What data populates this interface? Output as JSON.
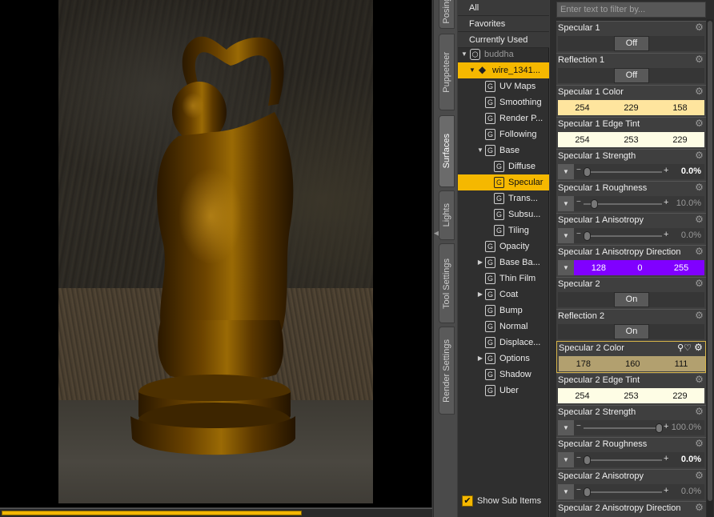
{
  "viewport": {
    "progress": 0.7
  },
  "side_tabs": [
    {
      "label": "Posing",
      "active": false
    },
    {
      "label": "Puppeteer",
      "active": false
    },
    {
      "label": "Surfaces",
      "active": true
    },
    {
      "label": "Lights",
      "active": false
    },
    {
      "label": "Tool Settings",
      "active": false
    },
    {
      "label": "Render Settings",
      "active": false
    }
  ],
  "tree": {
    "categories": [
      "All",
      "Favorites",
      "Currently Used"
    ],
    "figure": "buddha",
    "selected_object": "wire_1341...",
    "items": [
      {
        "label": "UV Maps"
      },
      {
        "label": "Smoothing"
      },
      {
        "label": "Render P..."
      },
      {
        "label": "Following"
      },
      {
        "label": "Base"
      },
      {
        "label": "Diffuse"
      },
      {
        "label": "Specular"
      },
      {
        "label": "Trans..."
      },
      {
        "label": "Subsu..."
      },
      {
        "label": "Tiling"
      },
      {
        "label": "Opacity"
      },
      {
        "label": "Base Ba..."
      },
      {
        "label": "Thin Film"
      },
      {
        "label": "Coat"
      },
      {
        "label": "Bump"
      },
      {
        "label": "Normal"
      },
      {
        "label": "Displace..."
      },
      {
        "label": "Options"
      },
      {
        "label": "Shadow"
      },
      {
        "label": "Uber"
      }
    ],
    "show_sub_items": "Show Sub Items"
  },
  "properties": {
    "filter_placeholder": "Enter text to filter by...",
    "items": [
      {
        "name": "Specular 1",
        "kind": "toggle",
        "value": "Off"
      },
      {
        "name": "Reflection 1",
        "kind": "toggle",
        "value": "Off"
      },
      {
        "name": "Specular 1 Color",
        "kind": "color",
        "rgb": [
          "254",
          "229",
          "158"
        ],
        "color": "#fee59e"
      },
      {
        "name": "Specular 1 Edge Tint",
        "kind": "color",
        "rgb": [
          "254",
          "253",
          "229"
        ],
        "color": "#fefde5"
      },
      {
        "name": "Specular 1 Strength",
        "kind": "slider",
        "value": "0.0%",
        "fraction": 0.0,
        "bold": true
      },
      {
        "name": "Specular 1 Roughness",
        "kind": "slider",
        "value": "10.0%",
        "fraction": 0.1,
        "bold": false
      },
      {
        "name": "Specular 1 Anisotropy",
        "kind": "slider",
        "value": "0.0%",
        "fraction": 0.0,
        "bold": false
      },
      {
        "name": "Specular 1 Anisotropy Direction",
        "kind": "vector",
        "rgb": [
          "128",
          "0",
          "255"
        ],
        "color": "#8000ff"
      },
      {
        "name": "Specular 2",
        "kind": "toggle",
        "value": "On"
      },
      {
        "name": "Reflection 2",
        "kind": "toggle",
        "value": "On"
      },
      {
        "name": "Specular 2 Color",
        "kind": "color",
        "rgb": [
          "178",
          "160",
          "111"
        ],
        "color": "#b2a06f",
        "highlighted": true
      },
      {
        "name": "Specular 2 Edge Tint",
        "kind": "color",
        "rgb": [
          "254",
          "253",
          "229"
        ],
        "color": "#fefde5"
      },
      {
        "name": "Specular 2 Strength",
        "kind": "slider",
        "value": "100.0%",
        "fraction": 1.0,
        "bold": false
      },
      {
        "name": "Specular 2 Roughness",
        "kind": "slider",
        "value": "0.0%",
        "fraction": 0.0,
        "bold": true
      },
      {
        "name": "Specular 2 Anisotropy",
        "kind": "slider",
        "value": "0.0%",
        "fraction": 0.0,
        "bold": false
      },
      {
        "name": "Specular 2 Anisotropy Direction",
        "kind": "header"
      }
    ]
  },
  "colors": {
    "accent": "#f5b800",
    "panel": "#3f3f3f"
  }
}
